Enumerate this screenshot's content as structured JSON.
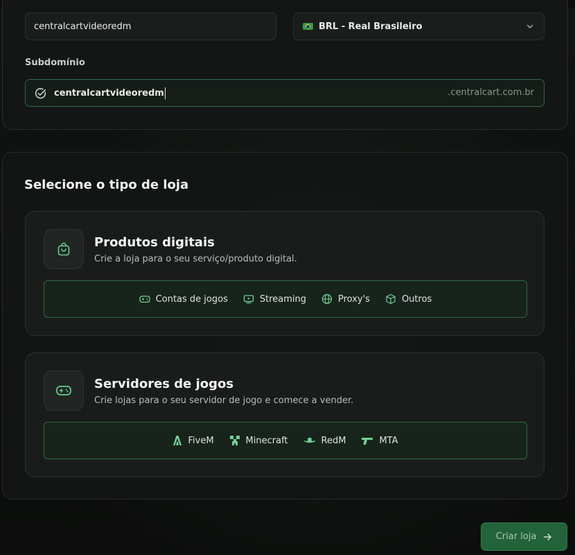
{
  "store": {
    "name_value": "centralcartvideoredm",
    "currency_value": "BRL - Real Brasileiro",
    "currency_flag_icon": "brazil-flag-icon",
    "subdomain_label": "Subdomínio",
    "subdomain_value": "centralcartvideoredm",
    "subdomain_suffix": ".centralcart.com.br"
  },
  "store_type": {
    "title": "Selecione o tipo de loja",
    "options": [
      {
        "title": "Produtos digitais",
        "description": "Crie a loja para o seu serviço/produto digital.",
        "icon": "shopping-bag-icon",
        "tags": [
          "Contas de jogos",
          "Streaming",
          "Proxy's",
          "Outros"
        ]
      },
      {
        "title": "Servidores de jogos",
        "description": "Crie lojas para o seu servidor de jogo e comece a vender.",
        "icon": "gamepad-icon",
        "tags": [
          "FiveM",
          "Minecraft",
          "RedM",
          "MTA"
        ]
      }
    ]
  },
  "actions": {
    "create_label": "Criar loja"
  },
  "colors": {
    "accent": "#2f6b45",
    "button": "#23633a",
    "background": "#0f1110"
  }
}
